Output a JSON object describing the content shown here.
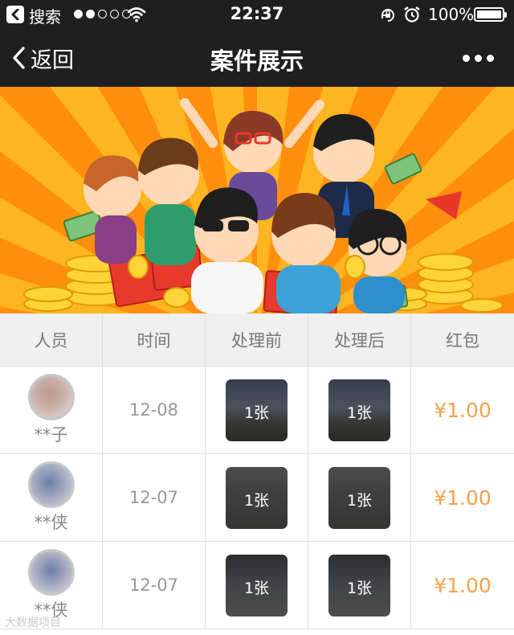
{
  "status_bar": {
    "source_app": "搜索",
    "time": "22:37",
    "battery": "100%",
    "signal_dots_filled": 2,
    "signal_dots_total": 5
  },
  "nav": {
    "back_label": "返回",
    "title": "案件展示"
  },
  "table": {
    "headers": [
      "人员",
      "时间",
      "处理前",
      "处理后",
      "红包"
    ],
    "rows": [
      {
        "name": "**子",
        "date": "12-08",
        "before_count": "1张",
        "after_count": "1张",
        "red_packet": "¥1.00"
      },
      {
        "name": "**侠",
        "date": "12-07",
        "before_count": "1张",
        "after_count": "1张",
        "red_packet": "¥1.00"
      },
      {
        "name": "**侠",
        "date": "12-07",
        "before_count": "1张",
        "after_count": "1张",
        "red_packet": "¥1.00"
      }
    ]
  },
  "watermark": "大数据项目",
  "colors": {
    "bar_background": "#1f1f1f",
    "money": "#f5a24a",
    "header_background": "#f0f0f0",
    "banner_orange": "#ff8f0d"
  }
}
